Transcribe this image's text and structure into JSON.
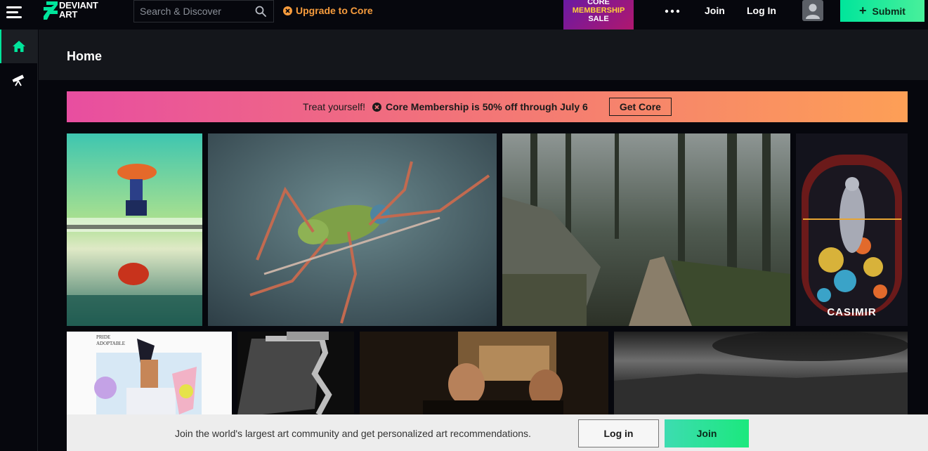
{
  "header": {
    "logo_line1": "DEVIANT",
    "logo_line2": "ART",
    "search_placeholder": "Search & Discover",
    "upgrade_label": "Upgrade to Core",
    "promo": {
      "line1": "CORE",
      "line2": "MEMBERSHIP",
      "line3": "SALE"
    },
    "join_label": "Join",
    "login_label": "Log In",
    "submit_label": "Submit"
  },
  "sidebar": {
    "items": [
      {
        "name": "home",
        "icon": "home-icon",
        "active": true
      },
      {
        "name": "discover",
        "icon": "telescope-icon",
        "active": false
      }
    ]
  },
  "page": {
    "title": "Home"
  },
  "banner": {
    "lead": "Treat yourself!",
    "offer": "Core Membership is 50% off through July 6",
    "cta": "Get Core"
  },
  "gallery": {
    "row1": [
      {
        "subject": "umbrella-girl-painting"
      },
      {
        "subject": "grasshopper-macro"
      },
      {
        "subject": "foggy-forest-path"
      },
      {
        "subject": "casimir-artwork",
        "caption": "CASIMIR"
      }
    ],
    "row2": [
      {
        "subject": "pride-adoptable",
        "caption_line1": "PRIDE",
        "caption_line2": "ADOPTABLE"
      },
      {
        "subject": "number-3-sculpture"
      },
      {
        "subject": "two-men-working"
      },
      {
        "subject": "stormy-landscape"
      }
    ]
  },
  "joinbar": {
    "text": "Join the world's largest art community and get personalized art recommendations.",
    "login_label": "Log in",
    "join_label": "Join"
  },
  "colors": {
    "accent_green": "#00e59b",
    "upgrade_orange": "#f79c3d",
    "background": "#06070d"
  }
}
